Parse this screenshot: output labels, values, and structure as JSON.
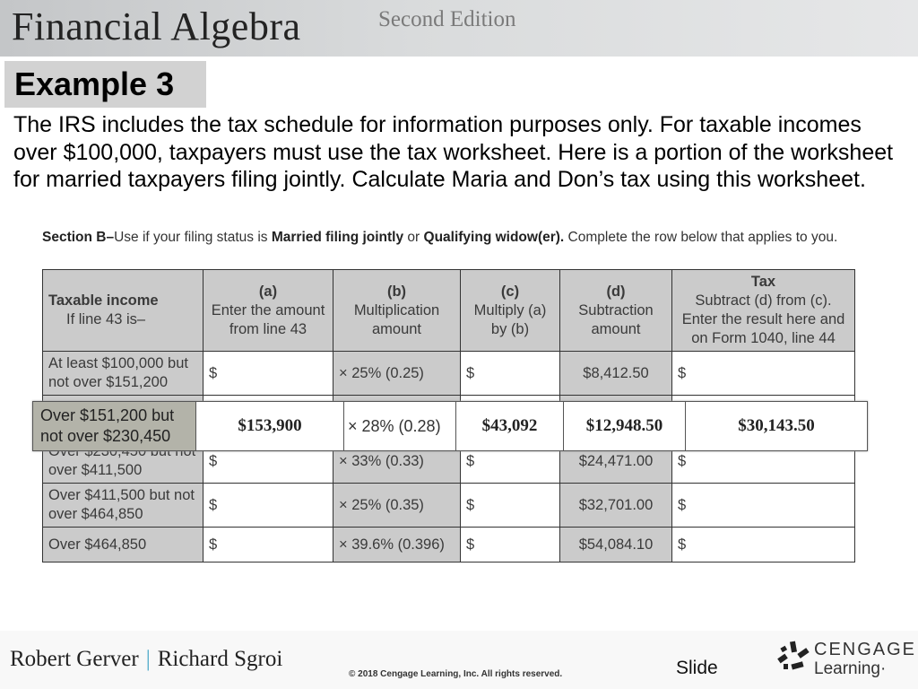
{
  "header": {
    "title": "Financial Algebra",
    "subtitle": "Second Edition"
  },
  "example": {
    "label": "Example 3"
  },
  "body_text": "The IRS includes the tax schedule for information purposes only. For taxable incomes over $100,000, taxpayers must use the tax worksheet. Here is a portion of the worksheet for married taxpayers filing jointly. Calculate Maria and Don’s tax using this worksheet.",
  "section_note": {
    "section": "Section B–",
    "text1": "Use if your filing status is ",
    "status1": "Married filing jointly",
    "text2": " or ",
    "status2": "Qualifying widow(er).",
    "text3": " Complete the row below that applies to you."
  },
  "worksheet": {
    "headers": {
      "income_title": "Taxable income",
      "income_sub": "If line 43 is–",
      "a_title": "(a)",
      "a_sub": "Enter the amount from line 43",
      "b_title": "(b)",
      "b_sub": "Multiplication amount",
      "c_title": "(c)",
      "c_sub": "Multiply (a) by (b)",
      "d_title": "(d)",
      "d_sub": "Subtraction amount",
      "tax_title": "Tax",
      "tax_sub": "Subtract (d) from (c). Enter the result here and on Form 1040, line 44"
    },
    "rows": [
      {
        "range": "At least $100,000 but not over $151,200",
        "a": "$",
        "b": "× 25% (0.25)",
        "c": "$",
        "d": "$8,412.50",
        "tax": "$"
      },
      {
        "range": "Over $230,450 but not over $411,500",
        "a": "$",
        "b": "× 33% (0.33)",
        "c": "$",
        "d": "$24,471.00",
        "tax": "$"
      },
      {
        "range": "Over $411,500 but not over $464,850",
        "a": "$",
        "b": "× 25% (0.35)",
        "c": "$",
        "d": "$32,701.00",
        "tax": "$"
      },
      {
        "range": "Over $464,850",
        "a": "$",
        "b": "× 39.6% (0.396)",
        "c": "$",
        "d": "$54,084.10",
        "tax": "$"
      }
    ],
    "highlight": {
      "range": "Over $151,200 but not over $230,450",
      "a": "$153,900",
      "b": "× 28%  (0.28)",
      "c": "$43,092",
      "d": "$12,948.50",
      "tax": "$30,143.50"
    }
  },
  "footer": {
    "author1": "Robert Gerver",
    "separator": "|",
    "author2": "Richard Sgroi",
    "copyright": "© 2018 Cengage Learning, Inc. All rights reserved.",
    "slide_label": "Slide",
    "logo_line1": "CENGAGE",
    "logo_line2": "Learning·"
  }
}
